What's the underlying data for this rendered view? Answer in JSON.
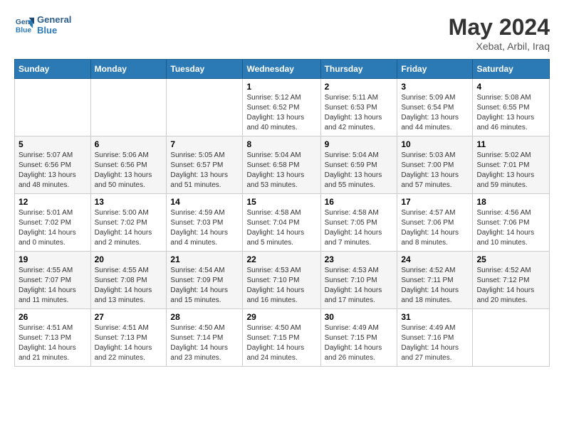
{
  "header": {
    "logo_line1": "General",
    "logo_line2": "Blue",
    "month": "May 2024",
    "location": "Xebat, Arbil, Iraq"
  },
  "days_of_week": [
    "Sunday",
    "Monday",
    "Tuesday",
    "Wednesday",
    "Thursday",
    "Friday",
    "Saturday"
  ],
  "weeks": [
    [
      {
        "day": "",
        "info": ""
      },
      {
        "day": "",
        "info": ""
      },
      {
        "day": "",
        "info": ""
      },
      {
        "day": "1",
        "info": "Sunrise: 5:12 AM\nSunset: 6:52 PM\nDaylight: 13 hours\nand 40 minutes."
      },
      {
        "day": "2",
        "info": "Sunrise: 5:11 AM\nSunset: 6:53 PM\nDaylight: 13 hours\nand 42 minutes."
      },
      {
        "day": "3",
        "info": "Sunrise: 5:09 AM\nSunset: 6:54 PM\nDaylight: 13 hours\nand 44 minutes."
      },
      {
        "day": "4",
        "info": "Sunrise: 5:08 AM\nSunset: 6:55 PM\nDaylight: 13 hours\nand 46 minutes."
      }
    ],
    [
      {
        "day": "5",
        "info": "Sunrise: 5:07 AM\nSunset: 6:56 PM\nDaylight: 13 hours\nand 48 minutes."
      },
      {
        "day": "6",
        "info": "Sunrise: 5:06 AM\nSunset: 6:56 PM\nDaylight: 13 hours\nand 50 minutes."
      },
      {
        "day": "7",
        "info": "Sunrise: 5:05 AM\nSunset: 6:57 PM\nDaylight: 13 hours\nand 51 minutes."
      },
      {
        "day": "8",
        "info": "Sunrise: 5:04 AM\nSunset: 6:58 PM\nDaylight: 13 hours\nand 53 minutes."
      },
      {
        "day": "9",
        "info": "Sunrise: 5:04 AM\nSunset: 6:59 PM\nDaylight: 13 hours\nand 55 minutes."
      },
      {
        "day": "10",
        "info": "Sunrise: 5:03 AM\nSunset: 7:00 PM\nDaylight: 13 hours\nand 57 minutes."
      },
      {
        "day": "11",
        "info": "Sunrise: 5:02 AM\nSunset: 7:01 PM\nDaylight: 13 hours\nand 59 minutes."
      }
    ],
    [
      {
        "day": "12",
        "info": "Sunrise: 5:01 AM\nSunset: 7:02 PM\nDaylight: 14 hours\nand 0 minutes."
      },
      {
        "day": "13",
        "info": "Sunrise: 5:00 AM\nSunset: 7:02 PM\nDaylight: 14 hours\nand 2 minutes."
      },
      {
        "day": "14",
        "info": "Sunrise: 4:59 AM\nSunset: 7:03 PM\nDaylight: 14 hours\nand 4 minutes."
      },
      {
        "day": "15",
        "info": "Sunrise: 4:58 AM\nSunset: 7:04 PM\nDaylight: 14 hours\nand 5 minutes."
      },
      {
        "day": "16",
        "info": "Sunrise: 4:58 AM\nSunset: 7:05 PM\nDaylight: 14 hours\nand 7 minutes."
      },
      {
        "day": "17",
        "info": "Sunrise: 4:57 AM\nSunset: 7:06 PM\nDaylight: 14 hours\nand 8 minutes."
      },
      {
        "day": "18",
        "info": "Sunrise: 4:56 AM\nSunset: 7:06 PM\nDaylight: 14 hours\nand 10 minutes."
      }
    ],
    [
      {
        "day": "19",
        "info": "Sunrise: 4:55 AM\nSunset: 7:07 PM\nDaylight: 14 hours\nand 11 minutes."
      },
      {
        "day": "20",
        "info": "Sunrise: 4:55 AM\nSunset: 7:08 PM\nDaylight: 14 hours\nand 13 minutes."
      },
      {
        "day": "21",
        "info": "Sunrise: 4:54 AM\nSunset: 7:09 PM\nDaylight: 14 hours\nand 15 minutes."
      },
      {
        "day": "22",
        "info": "Sunrise: 4:53 AM\nSunset: 7:10 PM\nDaylight: 14 hours\nand 16 minutes."
      },
      {
        "day": "23",
        "info": "Sunrise: 4:53 AM\nSunset: 7:10 PM\nDaylight: 14 hours\nand 17 minutes."
      },
      {
        "day": "24",
        "info": "Sunrise: 4:52 AM\nSunset: 7:11 PM\nDaylight: 14 hours\nand 18 minutes."
      },
      {
        "day": "25",
        "info": "Sunrise: 4:52 AM\nSunset: 7:12 PM\nDaylight: 14 hours\nand 20 minutes."
      }
    ],
    [
      {
        "day": "26",
        "info": "Sunrise: 4:51 AM\nSunset: 7:13 PM\nDaylight: 14 hours\nand 21 minutes."
      },
      {
        "day": "27",
        "info": "Sunrise: 4:51 AM\nSunset: 7:13 PM\nDaylight: 14 hours\nand 22 minutes."
      },
      {
        "day": "28",
        "info": "Sunrise: 4:50 AM\nSunset: 7:14 PM\nDaylight: 14 hours\nand 23 minutes."
      },
      {
        "day": "29",
        "info": "Sunrise: 4:50 AM\nSunset: 7:15 PM\nDaylight: 14 hours\nand 24 minutes."
      },
      {
        "day": "30",
        "info": "Sunrise: 4:49 AM\nSunset: 7:15 PM\nDaylight: 14 hours\nand 26 minutes."
      },
      {
        "day": "31",
        "info": "Sunrise: 4:49 AM\nSunset: 7:16 PM\nDaylight: 14 hours\nand 27 minutes."
      },
      {
        "day": "",
        "info": ""
      }
    ]
  ]
}
